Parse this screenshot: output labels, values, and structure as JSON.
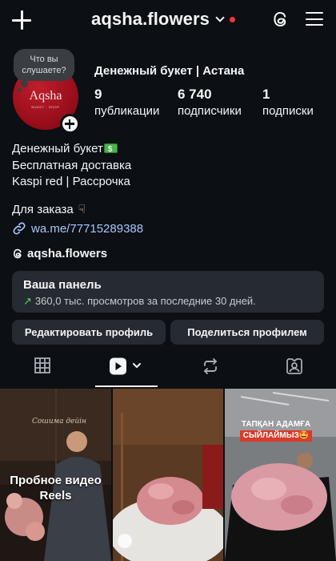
{
  "header": {
    "username": "aqsha.flowers",
    "icons": [
      "plus-icon",
      "chevron-down-icon",
      "threads-icon",
      "menu-icon"
    ]
  },
  "profile": {
    "note": "Что вы слушаете?",
    "avatar_logo": "Aqsha",
    "avatar_sub": "BUKET · SHOP",
    "full_name": "Денежный букет | Астана",
    "stats": [
      {
        "num": "9",
        "label": "публикации"
      },
      {
        "num": "6 740",
        "label": "подписчики"
      },
      {
        "num": "1",
        "label": "подписки"
      }
    ],
    "bio": [
      "Денежный букет",
      "Бесплатная доставка",
      "Kaspi red | Рассрочка"
    ],
    "order_line": "Для заказа",
    "link": "wa.me/77715289388",
    "threads_handle": "aqsha.flowers"
  },
  "dashboard": {
    "title": "Ваша панель",
    "subtitle": "360,0 тыс. просмотров за последние 30 дней."
  },
  "buttons": {
    "edit": "Редактировать профиль",
    "share": "Поделиться профилем"
  },
  "tabs": [
    "grid-icon",
    "reels-icon",
    "reposts-icon",
    "tagged-icon"
  ],
  "grid": {
    "tile1_script": "Сошима дейін",
    "tile1_caption": "Пробное видео Reels",
    "tile3_banner_line1": "ТАПҚАН АДАМҒА",
    "tile3_banner_line2": "СЫЙЛАЙМЫЗ🤩"
  },
  "colors": {
    "background": "#0c0f14",
    "link": "#a8c7fa",
    "notification": "#ff3040",
    "panel": "#262a31",
    "trend": "#4cd964"
  }
}
